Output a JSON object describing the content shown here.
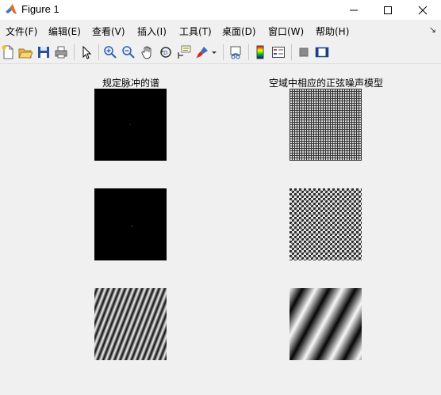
{
  "window": {
    "title": "Figure 1"
  },
  "menu": {
    "file": "文件(F)",
    "edit": "编辑(E)",
    "view": "查看(V)",
    "insert": "插入(I)",
    "tools": "工具(T)",
    "desktop": "桌面(D)",
    "window": "窗口(W)",
    "help": "帮助(H)"
  },
  "toolbar": {
    "icons": [
      "new-figure-icon",
      "open-file-icon",
      "save-icon",
      "print-icon",
      "edit-plot-arrow-icon",
      "zoom-in-icon",
      "zoom-out-icon",
      "pan-hand-icon",
      "rotate-3d-icon",
      "data-cursor-icon",
      "brush-icon",
      "link-plot-icon",
      "insert-colorbar-icon",
      "insert-legend-icon",
      "hide-plot-tools-icon",
      "show-plot-tools-icon"
    ]
  },
  "figure": {
    "left_title": "规定脉冲的谱",
    "right_title": "空域中相应的正弦噪声模型"
  },
  "colors": {
    "titlebar": "#ffffff",
    "background": "#f0f0f0"
  }
}
